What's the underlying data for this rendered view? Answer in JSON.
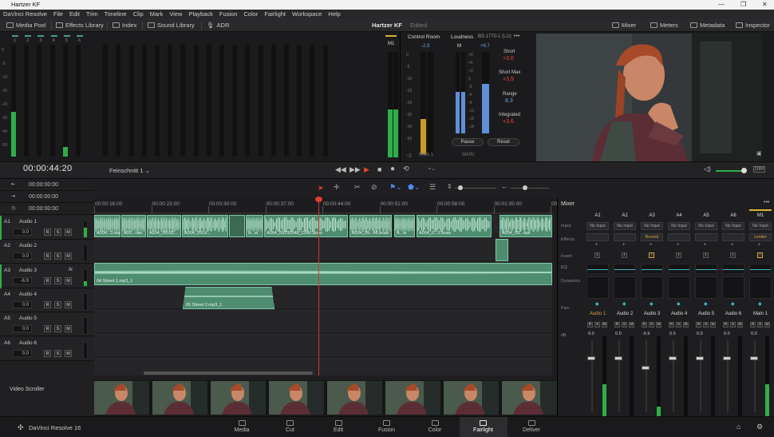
{
  "window": {
    "title": "Hartzer KF"
  },
  "menu": [
    "DaVinci Resolve",
    "File",
    "Edit",
    "Trim",
    "Timeline",
    "Clip",
    "Mark",
    "View",
    "Playback",
    "Fusion",
    "Color",
    "Fairlight",
    "Workspace",
    "Help"
  ],
  "toolbar": {
    "media_pool": "Media Pool",
    "effects_library": "Effects Library",
    "index": "Index",
    "sound_library": "Sound Library",
    "adr": "ADR",
    "project_name": "Hartzer KF",
    "status": "Edited",
    "mixer": "Mixer",
    "meters": "Meters",
    "metadata": "Metadata",
    "inspector": "Inspector"
  },
  "meters_panel": {
    "channels": [
      "1",
      "2",
      "3",
      "4",
      "5",
      "6"
    ],
    "scale": [
      "0",
      "-5",
      "-10",
      "-15",
      "-20",
      "-30",
      "-40",
      "-50"
    ],
    "main_label": "M1"
  },
  "control_room": {
    "title": "Control Room",
    "peak": "-2.9",
    "scale": [
      "0",
      "-5",
      "-10",
      "-15",
      "-20",
      "-30",
      "-40",
      "-50"
    ],
    "footer": "Main 1"
  },
  "loudness": {
    "title": "Loudness",
    "standard": "BS.1770-1 (LU)",
    "m_label": "M",
    "peak": "+6.7",
    "scale": [
      "+9",
      "+6",
      "+3",
      "0",
      "-3",
      "-6",
      "-9",
      "-12",
      "-15",
      "-18"
    ],
    "short_label": "Short",
    "short_value": "+3.0",
    "short_max_label": "Short Max",
    "short_max_value": "+3.9",
    "range_label": "Range",
    "range_value": "8.3",
    "integrated_label": "Integrated",
    "integrated_value": "+3.6",
    "pause": "Pause",
    "reset": "Reset",
    "footer": "MAIN"
  },
  "timeline_header": {
    "timecode": "00:00:44:20",
    "timeline_name": "Feinschnitt 1",
    "tc_rows": [
      "00:00:00:00",
      "00:00:00:00",
      "00:00:00:00"
    ]
  },
  "ruler": {
    "labels": [
      "00:00:16:00",
      "00:00:23:00",
      "00:00:30:00",
      "00:00:37:00",
      "00:00:44:00",
      "00:00:51:00",
      "00:00:58:00",
      "00:01:05:00",
      "00:01:1"
    ]
  },
  "tracks": [
    {
      "id": "A1",
      "name": "Audio 1",
      "vol": "0.0",
      "fx": ""
    },
    {
      "id": "A2",
      "name": "Audio 2",
      "vol": "0.0",
      "fx": ""
    },
    {
      "id": "A3",
      "name": "Audio 3",
      "vol": "-6.9",
      "fx": "fx"
    },
    {
      "id": "A4",
      "name": "Audio 4",
      "vol": "0.0",
      "fx": ""
    },
    {
      "id": "A5",
      "name": "Audio 5",
      "vol": "0.0",
      "fx": ""
    },
    {
      "id": "A6",
      "name": "Audio 6",
      "vol": "0.0",
      "fx": ""
    }
  ],
  "track_buttons": {
    "r": "R",
    "s": "S",
    "m": "M"
  },
  "clips": {
    "a1": [
      "A004...3.wav",
      "A00...raw",
      "A004_09192...",
      "A004_0919...",
      "A...w",
      "A004_09192048_C042.braw",
      "A004_09...46.braw",
      "A...w",
      "A004_0...2.braw",
      "A004_09...raw"
    ],
    "a3": "04 Street 1.mp3_1",
    "a4": "05 Street 2.mp3_1"
  },
  "scroller": {
    "label": "Video Scroller"
  },
  "mixer": {
    "title": "Mixer",
    "channels": [
      "A1",
      "A2",
      "A3",
      "A4",
      "A5",
      "A6",
      "M1"
    ],
    "rows": {
      "input": "Input",
      "effects": "Effects",
      "insert": "Insert",
      "eq": "EQ",
      "dynamics": "Dynamics",
      "pan": "Pan",
      "db": "dB"
    },
    "inputs": [
      "No Input",
      "No Input",
      "No Input",
      "No Input",
      "No Input",
      "No Input",
      "No Input"
    ],
    "effects": [
      "",
      "",
      "Reverb",
      "",
      "",
      "",
      "Limiter"
    ],
    "names": [
      "Audio 1",
      "Audio 2",
      "Audio 3",
      "Audio 4",
      "Audio 5",
      "Audio 6",
      "Main 1"
    ],
    "db": [
      "0.0",
      "0.0",
      "-6.9",
      "0.0",
      "0.0",
      "0.0",
      "0.0"
    ]
  },
  "pages": [
    "Media",
    "Cut",
    "Edit",
    "Fusion",
    "Color",
    "Fairlight",
    "Deliver"
  ],
  "app": {
    "name": "DaVinci Resolve 16"
  }
}
